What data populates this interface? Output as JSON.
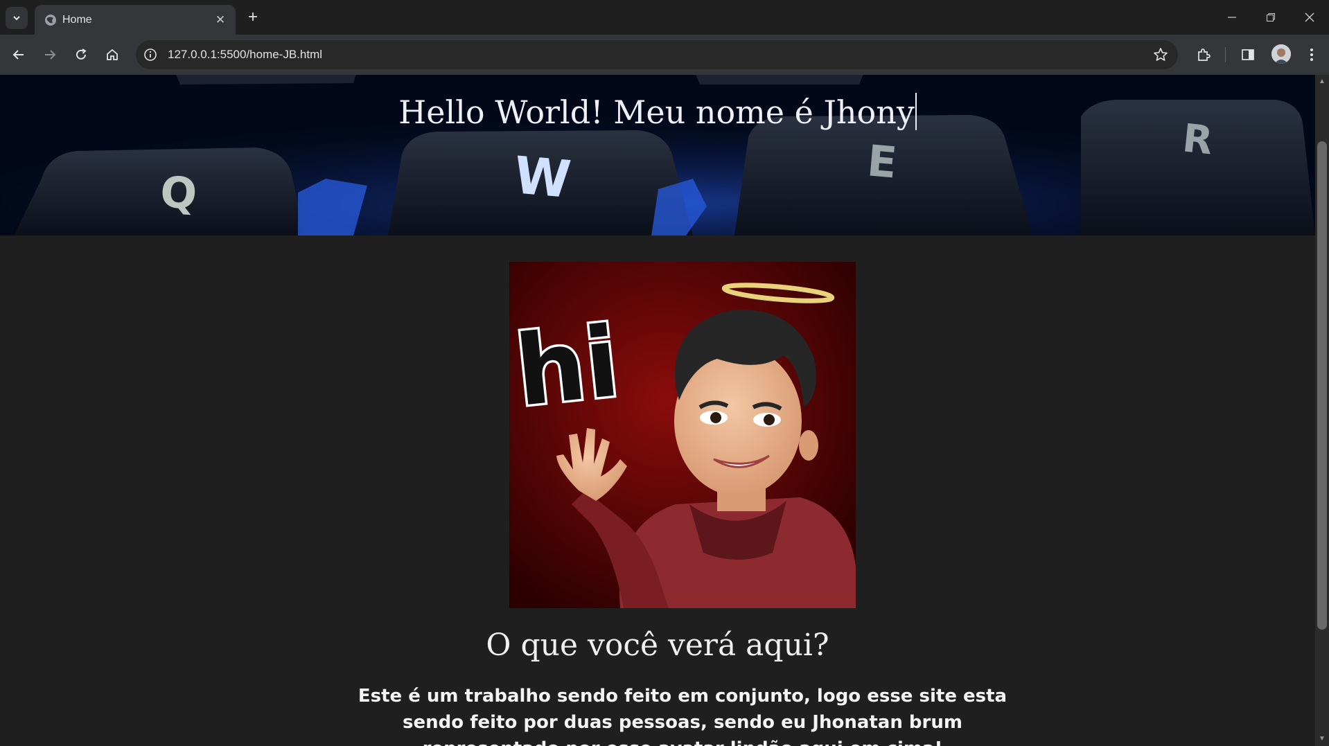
{
  "browser": {
    "tab_title": "Home",
    "url": "127.0.0.1:5500/home-JB.html"
  },
  "page": {
    "hero_title": "Hello World! Meu nome é Jhony",
    "section_title": "O que você verá aqui?",
    "paragraph": "Este é um trabalho sendo feito em conjunto, logo esse site esta sendo feito por duas pessoas, sendo eu Jhonatan brum representado por esse avatar lindão aqui em cima!",
    "avatar_text": "hi"
  },
  "colors": {
    "page_bg": "#1f1f1f",
    "hero_bg": "#020818",
    "avatar_bg": "#5a0000"
  }
}
